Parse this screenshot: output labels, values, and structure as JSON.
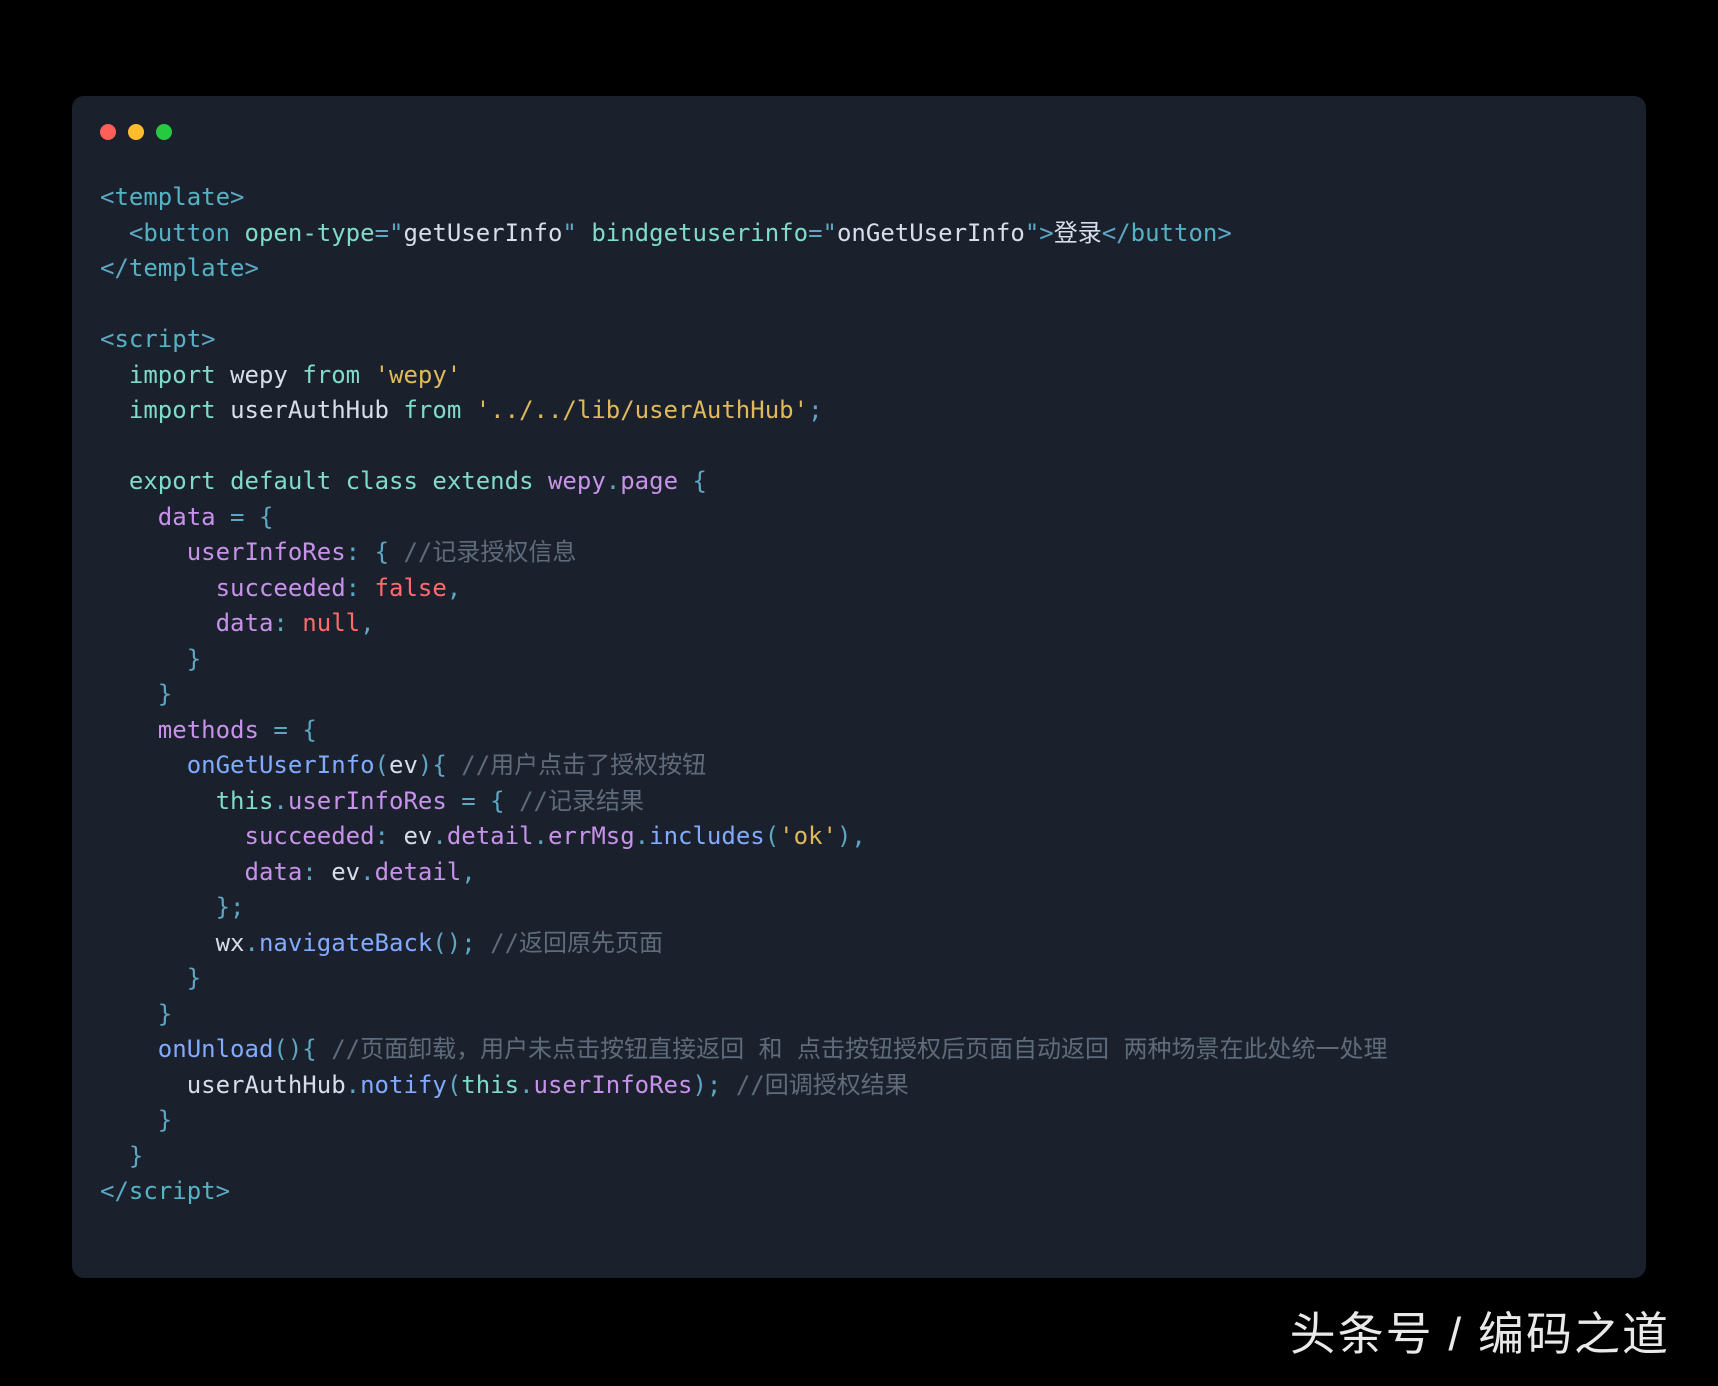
{
  "window": {
    "traffic_lights": [
      "red",
      "yellow",
      "green"
    ]
  },
  "code": {
    "lines": [
      {
        "indent": 0,
        "t": [
          [
            "punc",
            "<"
          ],
          [
            "tag",
            "template"
          ],
          [
            "punc",
            ">"
          ]
        ]
      },
      {
        "indent": 1,
        "t": [
          [
            "punc",
            "<"
          ],
          [
            "tag",
            "button"
          ],
          [
            "text",
            " "
          ],
          [
            "attr",
            "open-type"
          ],
          [
            "punc",
            "="
          ],
          [
            "punc",
            "\""
          ],
          [
            "str",
            "getUserInfo"
          ],
          [
            "punc",
            "\""
          ],
          [
            "text",
            " "
          ],
          [
            "attr",
            "bindgetuserinfo"
          ],
          [
            "punc",
            "="
          ],
          [
            "punc",
            "\""
          ],
          [
            "str",
            "onGetUserInfo"
          ],
          [
            "punc",
            "\""
          ],
          [
            "punc",
            ">"
          ],
          [
            "text",
            "登录"
          ],
          [
            "punc",
            "</"
          ],
          [
            "tag",
            "button"
          ],
          [
            "punc",
            ">"
          ]
        ]
      },
      {
        "indent": 0,
        "t": [
          [
            "punc",
            "</"
          ],
          [
            "tag",
            "template"
          ],
          [
            "punc",
            ">"
          ]
        ]
      },
      {
        "indent": 0,
        "t": []
      },
      {
        "indent": 0,
        "t": [
          [
            "punc",
            "<"
          ],
          [
            "tag",
            "script"
          ],
          [
            "punc",
            ">"
          ]
        ]
      },
      {
        "indent": 1,
        "t": [
          [
            "kw",
            "import"
          ],
          [
            "text",
            " "
          ],
          [
            "ident",
            "wepy"
          ],
          [
            "text",
            " "
          ],
          [
            "kw",
            "from"
          ],
          [
            "text",
            " "
          ],
          [
            "strq",
            "'wepy'"
          ]
        ]
      },
      {
        "indent": 1,
        "t": [
          [
            "kw",
            "import"
          ],
          [
            "text",
            " "
          ],
          [
            "ident",
            "userAuthHub"
          ],
          [
            "text",
            " "
          ],
          [
            "kw",
            "from"
          ],
          [
            "text",
            " "
          ],
          [
            "strq",
            "'../../lib/userAuthHub'"
          ],
          [
            "punc",
            ";"
          ]
        ]
      },
      {
        "indent": 0,
        "t": []
      },
      {
        "indent": 1,
        "t": [
          [
            "kw",
            "export"
          ],
          [
            "text",
            " "
          ],
          [
            "kw",
            "default"
          ],
          [
            "text",
            " "
          ],
          [
            "kw",
            "class"
          ],
          [
            "text",
            " "
          ],
          [
            "kw",
            "extends"
          ],
          [
            "text",
            " "
          ],
          [
            "prop",
            "wepy"
          ],
          [
            "punc",
            "."
          ],
          [
            "prop",
            "page"
          ],
          [
            "text",
            " "
          ],
          [
            "punc",
            "{"
          ]
        ]
      },
      {
        "indent": 2,
        "t": [
          [
            "prop",
            "data"
          ],
          [
            "text",
            " "
          ],
          [
            "punc",
            "="
          ],
          [
            "text",
            " "
          ],
          [
            "punc",
            "{"
          ]
        ]
      },
      {
        "indent": 3,
        "t": [
          [
            "prop",
            "userInfoRes"
          ],
          [
            "punc",
            ":"
          ],
          [
            "text",
            " "
          ],
          [
            "punc",
            "{"
          ],
          [
            "text",
            " "
          ],
          [
            "comment",
            "//记录授权信息"
          ]
        ]
      },
      {
        "indent": 4,
        "t": [
          [
            "prop",
            "succeeded"
          ],
          [
            "punc",
            ":"
          ],
          [
            "text",
            " "
          ],
          [
            "false",
            "false"
          ],
          [
            "punc",
            ","
          ]
        ]
      },
      {
        "indent": 4,
        "t": [
          [
            "prop",
            "data"
          ],
          [
            "punc",
            ":"
          ],
          [
            "text",
            " "
          ],
          [
            "null",
            "null"
          ],
          [
            "punc",
            ","
          ]
        ]
      },
      {
        "indent": 3,
        "t": [
          [
            "punc",
            "}"
          ]
        ]
      },
      {
        "indent": 2,
        "t": [
          [
            "punc",
            "}"
          ]
        ]
      },
      {
        "indent": 2,
        "t": [
          [
            "prop",
            "methods"
          ],
          [
            "text",
            " "
          ],
          [
            "punc",
            "="
          ],
          [
            "text",
            " "
          ],
          [
            "punc",
            "{"
          ]
        ]
      },
      {
        "indent": 3,
        "t": [
          [
            "call",
            "onGetUserInfo"
          ],
          [
            "punc",
            "("
          ],
          [
            "ident",
            "ev"
          ],
          [
            "punc",
            ")"
          ],
          [
            "punc",
            "{"
          ],
          [
            "text",
            " "
          ],
          [
            "comment",
            "//用户点击了授权按钮"
          ]
        ]
      },
      {
        "indent": 4,
        "t": [
          [
            "this",
            "this"
          ],
          [
            "punc",
            "."
          ],
          [
            "prop",
            "userInfoRes"
          ],
          [
            "text",
            " "
          ],
          [
            "punc",
            "="
          ],
          [
            "text",
            " "
          ],
          [
            "punc",
            "{"
          ],
          [
            "text",
            " "
          ],
          [
            "comment",
            "//记录结果"
          ]
        ]
      },
      {
        "indent": 5,
        "t": [
          [
            "prop",
            "succeeded"
          ],
          [
            "punc",
            ":"
          ],
          [
            "text",
            " "
          ],
          [
            "ident",
            "ev"
          ],
          [
            "punc",
            "."
          ],
          [
            "prop",
            "detail"
          ],
          [
            "punc",
            "."
          ],
          [
            "prop",
            "errMsg"
          ],
          [
            "punc",
            "."
          ],
          [
            "call",
            "includes"
          ],
          [
            "punc",
            "("
          ],
          [
            "strq",
            "'ok'"
          ],
          [
            "punc",
            ")"
          ],
          [
            "punc",
            ","
          ]
        ]
      },
      {
        "indent": 5,
        "t": [
          [
            "prop",
            "data"
          ],
          [
            "punc",
            ":"
          ],
          [
            "text",
            " "
          ],
          [
            "ident",
            "ev"
          ],
          [
            "punc",
            "."
          ],
          [
            "prop",
            "detail"
          ],
          [
            "punc",
            ","
          ]
        ]
      },
      {
        "indent": 4,
        "t": [
          [
            "punc",
            "}"
          ],
          [
            "punc",
            ";"
          ]
        ]
      },
      {
        "indent": 4,
        "t": [
          [
            "ident",
            "wx"
          ],
          [
            "punc",
            "."
          ],
          [
            "call",
            "navigateBack"
          ],
          [
            "punc",
            "("
          ],
          [
            "punc",
            ")"
          ],
          [
            "punc",
            ";"
          ],
          [
            "text",
            " "
          ],
          [
            "comment",
            "//返回原先页面"
          ]
        ]
      },
      {
        "indent": 3,
        "t": [
          [
            "punc",
            "}"
          ]
        ]
      },
      {
        "indent": 2,
        "t": [
          [
            "punc",
            "}"
          ]
        ]
      },
      {
        "indent": 2,
        "t": [
          [
            "call",
            "onUnload"
          ],
          [
            "punc",
            "("
          ],
          [
            "punc",
            ")"
          ],
          [
            "punc",
            "{"
          ],
          [
            "text",
            " "
          ],
          [
            "comment",
            "//页面卸载，用户未点击按钮直接返回 和 点击按钮授权后页面自动返回 两种场景在此处统一处理"
          ]
        ]
      },
      {
        "indent": 3,
        "t": [
          [
            "ident",
            "userAuthHub"
          ],
          [
            "punc",
            "."
          ],
          [
            "call",
            "notify"
          ],
          [
            "punc",
            "("
          ],
          [
            "this",
            "this"
          ],
          [
            "punc",
            "."
          ],
          [
            "prop",
            "userInfoRes"
          ],
          [
            "punc",
            ")"
          ],
          [
            "punc",
            ";"
          ],
          [
            "text",
            " "
          ],
          [
            "comment",
            "//回调授权结果"
          ]
        ]
      },
      {
        "indent": 2,
        "t": [
          [
            "punc",
            "}"
          ]
        ]
      },
      {
        "indent": 1,
        "t": [
          [
            "punc",
            "}"
          ]
        ]
      },
      {
        "indent": 0,
        "t": [
          [
            "punc",
            "</"
          ],
          [
            "tag",
            "script"
          ],
          [
            "punc",
            ">"
          ]
        ]
      }
    ]
  },
  "watermark": "头条号 / 编码之道"
}
